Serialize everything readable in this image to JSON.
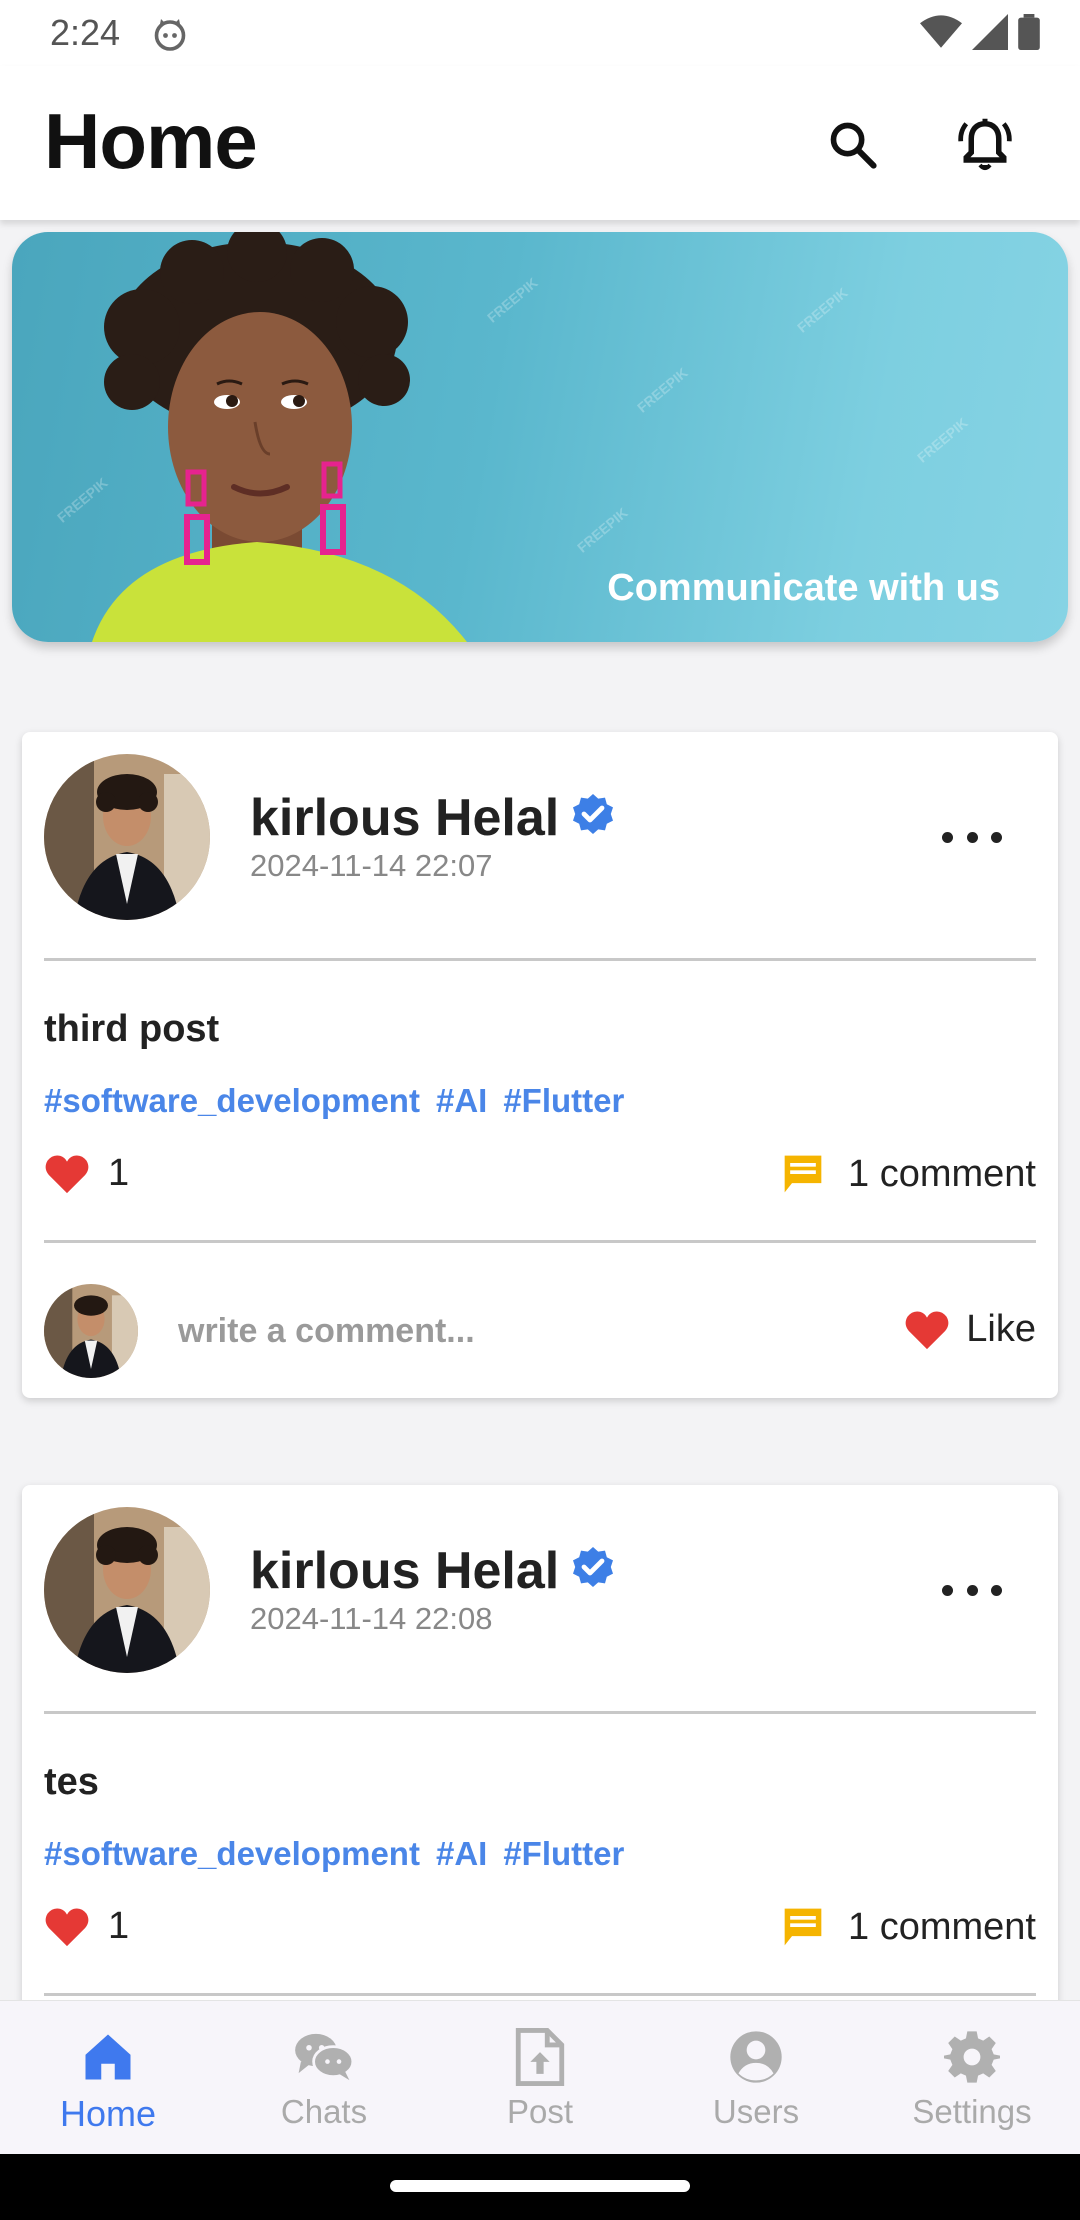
{
  "status": {
    "time": "2:24"
  },
  "app": {
    "title": "Home"
  },
  "banner": {
    "text": "Communicate with us",
    "watermark": "FREEPIK"
  },
  "posts": [
    {
      "author": "kirlous Helal",
      "date": "2024-11-14 22:07",
      "text": "third post",
      "tags": [
        "#software_development",
        "#AI",
        "#Flutter"
      ],
      "likes": "1",
      "comments": "1 comment",
      "comment_placeholder": "write a comment...",
      "like_label": "Like"
    },
    {
      "author": "kirlous Helal",
      "date": "2024-11-14 22:08",
      "text": "tes",
      "tags": [
        "#software_development",
        "#AI",
        "#Flutter"
      ],
      "likes": "1",
      "comments": "1 comment"
    }
  ],
  "nav": {
    "items": [
      {
        "label": "Home",
        "icon": "home-icon",
        "active": true
      },
      {
        "label": "Chats",
        "icon": "chats-icon",
        "active": false
      },
      {
        "label": "Post",
        "icon": "post-icon",
        "active": false
      },
      {
        "label": "Users",
        "icon": "users-icon",
        "active": false
      },
      {
        "label": "Settings",
        "icon": "settings-icon",
        "active": false
      }
    ]
  },
  "colors": {
    "accent": "#3f79ee",
    "tag": "#4a86e8",
    "heart": "#e53935",
    "comment_icon": "#f5b400",
    "verified": "#3d7fe6"
  }
}
